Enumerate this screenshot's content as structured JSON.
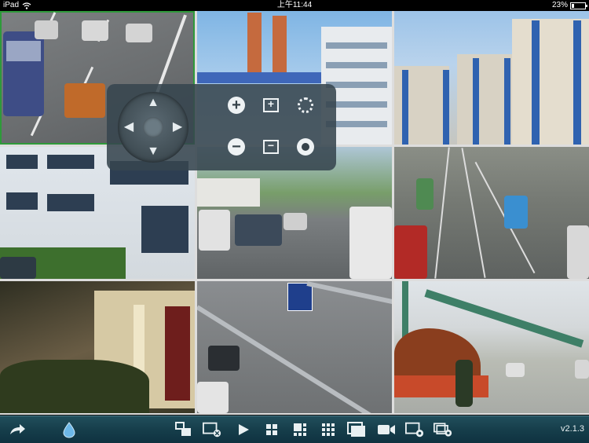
{
  "status_bar": {
    "device": "iPad",
    "time": "上午11:44",
    "battery": "23%"
  },
  "cameras": [
    {
      "id": "camera-1"
    },
    {
      "id": "camera-2"
    },
    {
      "id": "camera-3"
    },
    {
      "id": "camera-4"
    },
    {
      "id": "camera-5"
    },
    {
      "id": "camera-6"
    },
    {
      "id": "camera-7"
    },
    {
      "id": "camera-8"
    },
    {
      "id": "camera-9"
    }
  ],
  "ptz_panel": {
    "arrows": {
      "up": "▲",
      "down": "▼",
      "left": "◀",
      "right": "▶"
    },
    "zoom_in": "+",
    "zoom_out": "−",
    "focus_in": "+",
    "focus_out": "−"
  },
  "toolbar": {
    "version": "v2.1.3",
    "icons": [
      "back-arrow-icon",
      "drop-icon",
      "multi-view-icon",
      "close-video-icon",
      "play-icon",
      "grid-4-icon",
      "grid-6-icon",
      "grid-9-icon",
      "fullscreen-icon",
      "record-icon",
      "snapshot-icon",
      "playback-icon"
    ]
  },
  "colors": {
    "toolbar_bg": "#163e4b",
    "selection": "#2e9a3a",
    "ptz_bg": "#37464e"
  }
}
